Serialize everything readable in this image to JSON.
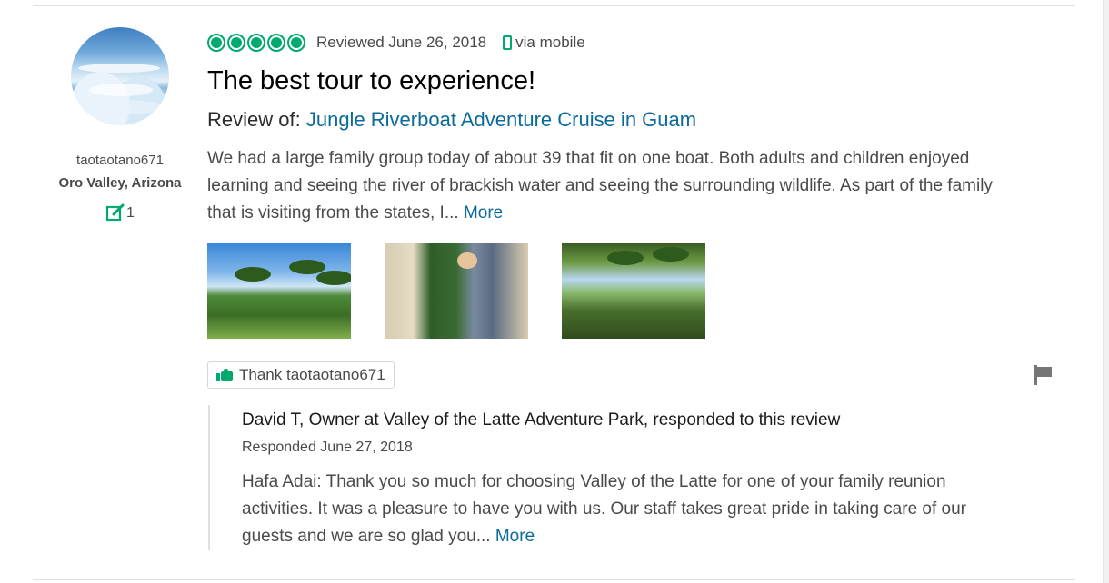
{
  "reviewer": {
    "username": "taotaotano671",
    "location": "Oro Valley, Arizona",
    "contributions": "1"
  },
  "review": {
    "rating_bubbles": 5,
    "reviewed_date": "Reviewed June 26, 2018",
    "via": "via mobile",
    "title": "The best tour to experience!",
    "review_of_label": "Review of:",
    "review_of_link": "Jungle Riverboat Adventure Cruise in Guam",
    "body": "We had a large family group today of about 39 that fit on one boat. Both adults and children enjoyed learning and seeing the river of brackish water and seeing the surrounding wildlife. As part of the family that is visiting from the states, I...",
    "more_label": "More",
    "photos": [
      "jungle-palms-photo",
      "family-on-boat-photo",
      "jungle-river-photo"
    ]
  },
  "actions": {
    "thank_label": "Thank taotaotano671"
  },
  "response": {
    "header": "David T, Owner at Valley of the Latte Adventure Park, responded to this review",
    "date": "Responded June 27, 2018",
    "body": "Hafa Adai: Thank you so much for choosing Valley of the Latte for one of your family reunion activities. It was a pleasure to have you with us. Our staff takes great pride in taking care of our guests and we are so glad you...",
    "more_label": "More"
  },
  "colors": {
    "accent_green": "#00aa6c",
    "link_blue": "#0b6a9c",
    "text": "#4a4a4a"
  }
}
